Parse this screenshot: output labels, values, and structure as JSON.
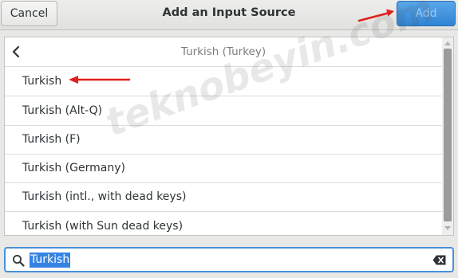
{
  "header": {
    "cancel_label": "Cancel",
    "title": "Add an Input Source",
    "add_label": "Add"
  },
  "list": {
    "header_title": "Turkish (Turkey)",
    "items": [
      {
        "label": "Turkish"
      },
      {
        "label": "Turkish (Alt-Q)"
      },
      {
        "label": "Turkish (F)"
      },
      {
        "label": "Turkish (Germany)"
      },
      {
        "label": "Turkish (intl., with dead keys)"
      },
      {
        "label": "Turkish (with Sun dead keys)"
      }
    ]
  },
  "search": {
    "value": "Turkish"
  },
  "watermark": "teknobeyin.com",
  "colors": {
    "accent": "#3584e4",
    "annotation": "#e0201b"
  },
  "icons": {
    "back": "chevron-left-icon",
    "search": "search-icon",
    "clear": "backspace-clear-icon"
  }
}
